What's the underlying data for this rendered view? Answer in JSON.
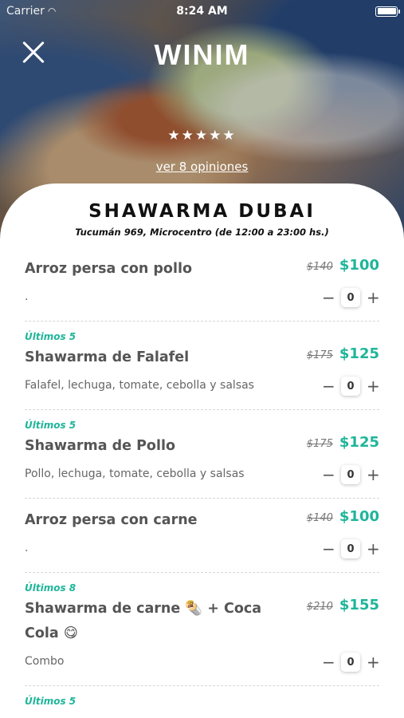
{
  "status_bar": {
    "carrier": "Carrier",
    "time": "8:24 AM"
  },
  "header": {
    "logo": "WINIM",
    "stars": "★★★★★",
    "reviews_link": "ver 8 opiniones"
  },
  "store": {
    "name": "SHAWARMA DUBAI",
    "address": "Tucumán 969, Microcentro (de 12:00 a 23:00 hs.)"
  },
  "items": [
    {
      "badge": "",
      "title": "Arroz persa con pollo",
      "old_price": "$140",
      "price": "$100",
      "desc": ".",
      "qty": "0"
    },
    {
      "badge": "Últimos 5",
      "title": "Shawarma de Falafel",
      "old_price": "$175",
      "price": "$125",
      "desc": "Falafel, lechuga, tomate, cebolla y salsas",
      "qty": "0"
    },
    {
      "badge": "Últimos 5",
      "title": "Shawarma de Pollo",
      "old_price": "$175",
      "price": "$125",
      "desc": "Pollo, lechuga, tomate, cebolla y salsas",
      "qty": "0"
    },
    {
      "badge": "",
      "title": "Arroz persa con carne",
      "old_price": "$140",
      "price": "$100",
      "desc": ".",
      "qty": "0"
    },
    {
      "badge": "Últimos 8",
      "title": "Shawarma de carne 🌯 + Coca Cola 😋",
      "old_price": "$210",
      "price": "$155",
      "desc": "Combo",
      "qty": "0"
    },
    {
      "badge": "Últimos 5",
      "title": "",
      "old_price": "",
      "price": "",
      "desc": "",
      "qty": ""
    }
  ],
  "stepper": {
    "minus": "−",
    "plus": "+"
  },
  "colors": {
    "accent": "#1fb59a",
    "text": "#555555"
  }
}
